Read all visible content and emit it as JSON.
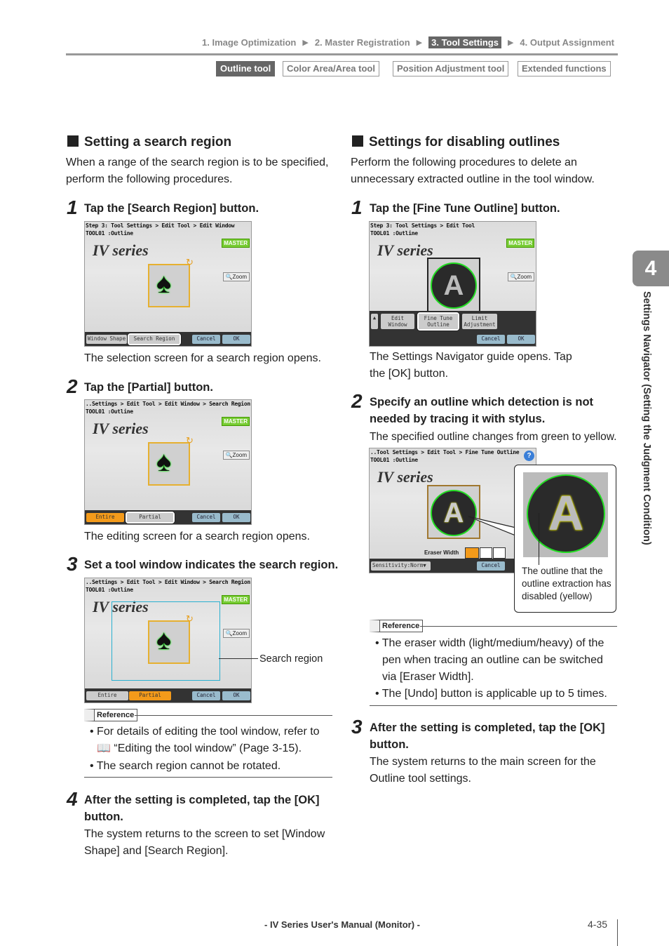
{
  "header": {
    "breadcrumb": [
      "1. Image Optimization",
      "2. Master Registration",
      "3. Tool Settings",
      "4. Output Assignment"
    ],
    "active_index": 2,
    "tabs": [
      "Outline tool",
      "Color Area/Area tool",
      "Position Adjustment tool",
      "Extended functions"
    ],
    "active_tab": 0
  },
  "left": {
    "heading": "Setting a search region",
    "intro": "When a range of the search region is to be specified, perform the following procedures.",
    "steps": [
      {
        "num": "1",
        "title": "Tap the [Search Region] button.",
        "caption": "The selection screen for a search region opens.",
        "shot": {
          "t1": "Step 3: Tool Settings > Edit Tool > Edit Window",
          "t2": "TOOL01 :Outline",
          "logo": "IV series",
          "master": "MASTER",
          "zoom": "Zoom",
          "buttons": [
            "Window Shape",
            "Search Region",
            "Cancel",
            "OK"
          ]
        }
      },
      {
        "num": "2",
        "title": "Tap the [Partial] button.",
        "caption": "The editing screen for a search region opens.",
        "shot": {
          "t1": "..Settings > Edit Tool > Edit Window > Search Region",
          "t2": "TOOL01 :Outline",
          "logo": "IV series",
          "master": "MASTER",
          "zoom": "Zoom",
          "buttons": [
            "Entire",
            "Partial",
            "Cancel",
            "OK"
          ]
        }
      },
      {
        "num": "3",
        "title": "Set a tool window indicates the search region.",
        "callout": "Search region",
        "shot": {
          "t1": "..Settings > Edit Tool > Edit Window > Search Region",
          "t2": "TOOL01 :Outline",
          "logo": "IV series",
          "master": "MASTER",
          "zoom": "Zoom",
          "buttons": [
            "Entire",
            "Partial",
            "Cancel",
            "OK"
          ]
        }
      },
      {
        "num": "4",
        "title": "After the setting is completed, tap the [OK] button.",
        "caption": "The system returns to the screen to set [Window Shape] and [Search Region]."
      }
    ],
    "reference": {
      "label": "Reference",
      "bullets": [
        "For details of editing the tool window, refer to",
        "“Editing the tool window” (Page 3-15).",
        "The search region cannot be rotated."
      ]
    }
  },
  "right": {
    "heading": "Settings for disabling outlines",
    "intro": "Perform the following procedures to delete an unnecessary extracted outline in the tool window.",
    "steps": [
      {
        "num": "1",
        "title": "Tap the [Fine Tune Outline] button.",
        "caption": "The Settings Navigator guide opens. Tap the [OK] button.",
        "shot": {
          "t1": "Step 3: Tool Settings > Edit Tool",
          "t2": "TOOL01 :Outline",
          "logo": "IV series",
          "master": "MASTER",
          "zoom": "Zoom",
          "buttons": [
            "Edit Window",
            "Fine Tune Outline",
            "Limit Adjustment",
            "Cancel",
            "OK"
          ],
          "glyph": "A"
        }
      },
      {
        "num": "2",
        "title": "Specify an outline which detection is not needed by tracing it with stylus.",
        "caption": "The specified outline changes from green to yellow.",
        "shot": {
          "t1": "..Tool Settings > Edit Tool > Fine Tune Outline",
          "t2": "TOOL01 :Outline",
          "logo": "IV series",
          "eraser": "Eraser Width",
          "sensitivity": "Sensitivity:Norm",
          "buttons": [
            "Cancel"
          ],
          "glyph": "A",
          "help": "?"
        },
        "callout": "The outline that the outline extraction has disabled (yellow)"
      },
      {
        "num": "3",
        "title": "After the setting is completed, tap the [OK] button.",
        "caption": "The system returns to the main screen for the Outline tool settings."
      }
    ],
    "reference": {
      "label": "Reference",
      "bullets": [
        "The eraser width (light/medium/heavy) of the pen when tracing an outline can be switched via [Eraser Width].",
        "The [Undo] button is applicable up to 5 times."
      ]
    }
  },
  "sidetab": {
    "chapter": "4",
    "title": "Settings Navigator (Setting the Judgment Condition)"
  },
  "footer": {
    "title": "- IV Series User's Manual (Monitor) -",
    "page": "4-35"
  }
}
